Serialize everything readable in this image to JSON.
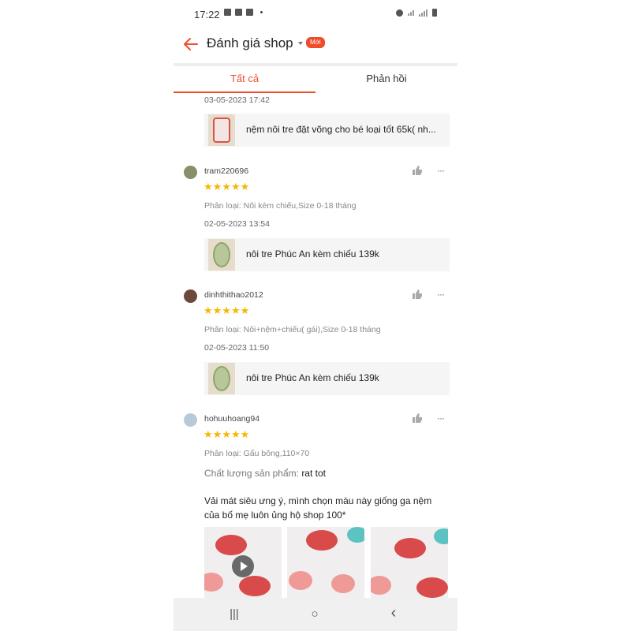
{
  "status": {
    "time": "17:22"
  },
  "header": {
    "title": "Đánh giá shop",
    "badge": "Mới"
  },
  "tabs": [
    {
      "label": "Tất cả",
      "active": true
    },
    {
      "label": "Phản hồi",
      "active": false
    }
  ],
  "colors": {
    "accent": "#ee4d2d",
    "star": "#f5b800"
  },
  "reviews": [
    {
      "date": "03-05-2023 17:42",
      "product": "nệm nôi tre đặt võng cho bé loại tốt 65k( nh..."
    },
    {
      "username": "tram220696",
      "stars": "★★★★★",
      "variant": "Phân loại: Nôi kèm chiếu,Size 0-18 tháng",
      "date": "02-05-2023 13:54",
      "product": "nôi tre Phúc An kèm chiếu 139k"
    },
    {
      "username": "dinhthithao2012",
      "stars": "★★★★★",
      "variant": "Phân loại: Nôi+nệm+chiếu( gái),Size 0-18 tháng",
      "date": "02-05-2023 11:50",
      "product": "nôi tre Phúc An kèm chiếu 139k"
    },
    {
      "username": "hohuuhoang94",
      "stars": "★★★★★",
      "variant": "Phân loại: Gấu bông,110×70",
      "quality_label": "Chất lượng sản phẩm:",
      "quality_value": "rat tot",
      "text_line1": "Vải mát siêu ưng ý, mình chọn màu này giống ga nệm",
      "text_line2": "của bố mẹ luôn ủng hộ shop 100*"
    }
  ],
  "navbar": {
    "recent": "|||",
    "home": "○",
    "back": "‹"
  }
}
